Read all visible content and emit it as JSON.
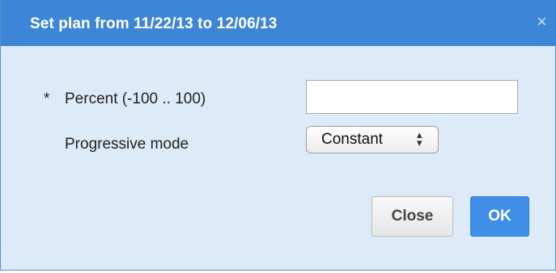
{
  "dialog": {
    "title": "Set plan from 11/22/13 to 12/06/13",
    "close_glyph": "×",
    "close_icon": "close-icon"
  },
  "form": {
    "percent": {
      "required_marker": "*",
      "label": "Percent (-100 .. 100)",
      "value": ""
    },
    "progressive_mode": {
      "label": "Progressive mode",
      "selected": "Constant",
      "arrows_icon": "select-updown-icon"
    }
  },
  "buttons": {
    "close_label": "Close",
    "ok_label": "OK"
  },
  "colors": {
    "titlebar": "#3d85d6",
    "body": "#ddeaf7",
    "primary_button": "#3f8ee8"
  }
}
